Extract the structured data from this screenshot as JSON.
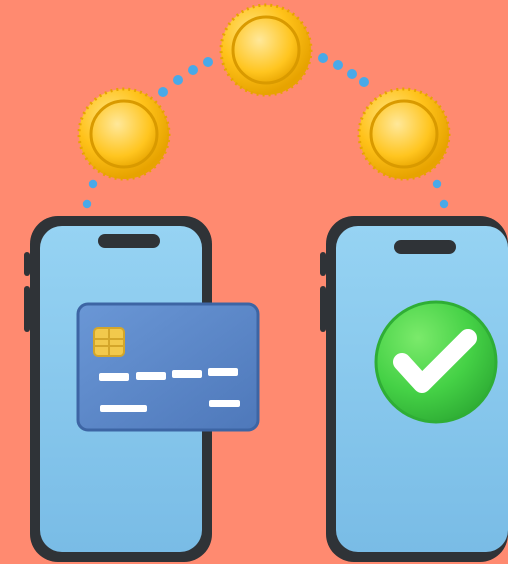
{
  "scene": {
    "background_color": "#FF8A70",
    "icons": [
      "phone-left",
      "phone-right",
      "credit-card",
      "chip-icon",
      "check-icon",
      "coin-left",
      "coin-center",
      "coin-right",
      "dotted-arc"
    ],
    "colors": {
      "phone_body": "#2F3337",
      "phone_screen": "#86C7EC",
      "notch": "#2F3337",
      "card": "#5B86C8",
      "card_stripe": "#FFFFFF",
      "chip": "#F2C94C",
      "coin": "#FFC21A",
      "coin_dark": "#E7A300",
      "dots": "#49A9E8",
      "check_badge": "#49D14B",
      "check_mark": "#FFFFFF"
    }
  }
}
